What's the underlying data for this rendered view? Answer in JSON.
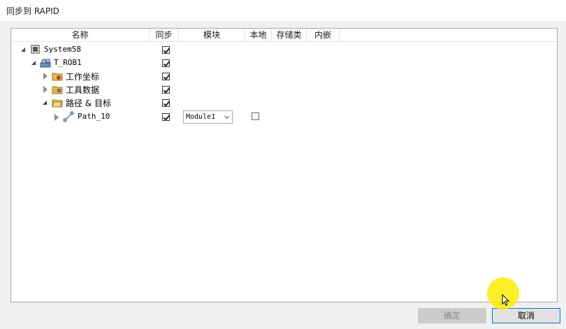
{
  "window": {
    "title": "同步到 RAPID"
  },
  "columns": [
    "名称",
    "同步",
    "模块",
    "本地",
    "存储类",
    "内嵌"
  ],
  "tree": [
    {
      "label": "System58",
      "icon": "station-icon",
      "expanded": true,
      "sync": true
    },
    {
      "label": "T_ROB1",
      "icon": "robot-task-icon",
      "expanded": true,
      "sync": true
    },
    {
      "label": "工作坐标",
      "icon": "workobject-folder-icon",
      "expanded": false,
      "sync": true
    },
    {
      "label": "工具数据",
      "icon": "tooldata-folder-icon",
      "expanded": false,
      "sync": true
    },
    {
      "label": "路径 & 目标",
      "icon": "paths-targets-folder-icon",
      "expanded": true,
      "sync": true
    },
    {
      "label": "Path_10",
      "icon": "path-icon",
      "expanded": false,
      "sync": true,
      "module": "Module1",
      "local": false
    }
  ],
  "buttons": {
    "ok": "确定",
    "cancel": "取消"
  },
  "colors": {
    "accent": "#0078d7",
    "folder": "#e8b84a",
    "highlight": "#ffec00"
  }
}
